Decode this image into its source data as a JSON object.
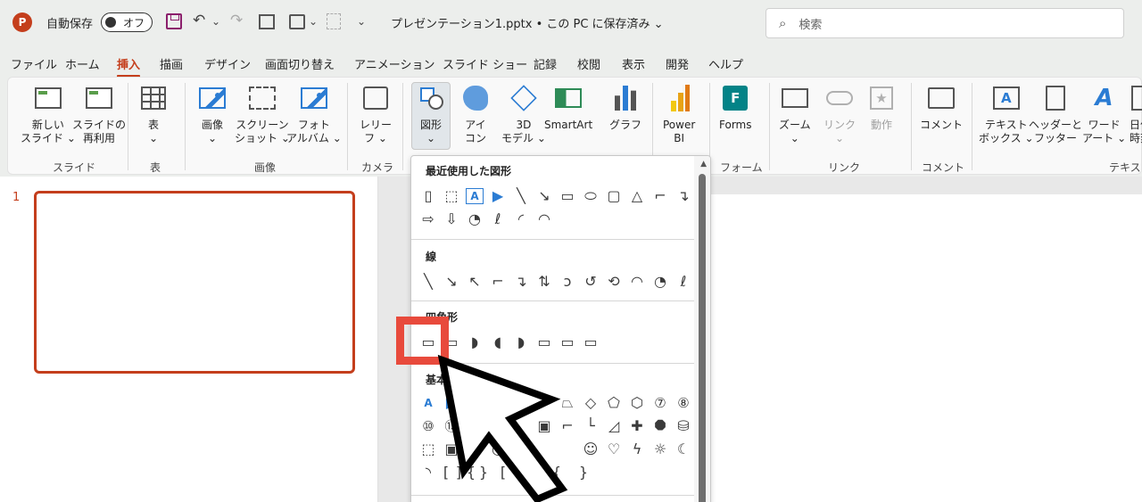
{
  "titlebar": {
    "logo_letter": "P",
    "autosave_label": "自動保存",
    "autosave_state": "オフ",
    "undo_glyph": "↶",
    "redo_glyph": "↷",
    "dropdown_glyph": "⌄",
    "doc_title": "プレゼンテーション1.pptx • この PC に保存済み ⌄",
    "search_placeholder": "検索"
  },
  "menu_tabs": [
    "ファイル",
    "ホーム",
    "挿入",
    "描画",
    "デザイン",
    "画面切り替え",
    "アニメーション",
    "スライド ショー",
    "記録",
    "校閲",
    "表示",
    "開発",
    "ヘルプ"
  ],
  "active_tab": "挿入",
  "ribbon": {
    "new_slide": "新しい\nスライド ⌄",
    "reuse_slide": "スライドの\n再利用",
    "table": "表\n⌄",
    "images": "画像\n⌄",
    "screenshot": "スクリーン\nショット ⌄",
    "photo_album": "フォト\nアルバム ⌄",
    "cameo": "レリー\nフ ⌄",
    "shapes": "図形\n⌄",
    "icons": "アイ\nコン",
    "model3d": "3D\nモデル ⌄",
    "smartart": "SmartArt",
    "chart": "グラフ",
    "powerbi": "Power\nBI",
    "forms": "Forms",
    "zoom": "ズーム\n⌄",
    "link": "リンク\n⌄",
    "action": "動作",
    "comment": "コメント",
    "textbox": "テキスト\nボックス ⌄",
    "header_footer": "ヘッダーと\nフッター",
    "wordart": "ワード\nアート ⌄",
    "date": "日付\n時刻",
    "groups": {
      "slides": "スライド",
      "tables": "表",
      "images": "画像",
      "camera": "カメラ",
      "forms": "フォーム",
      "links": "リンク",
      "comments": "コメント",
      "text": "テキスト"
    },
    "forms_icon_letter": "F",
    "textbox_icon_letter": "A",
    "wordart_icon_letter": "A",
    "action_icon_glyph": "★"
  },
  "slide_pane": {
    "slide_number": "1"
  },
  "shapes_menu": {
    "recent_header": "最近使用した図形",
    "recent_row1": [
      "▯",
      "⬚",
      "A",
      "▶",
      "╲",
      "↘",
      "▭",
      "⬭",
      "▢",
      "△",
      "⌐",
      "↴"
    ],
    "recent_row2": [
      "⇨",
      "⇩",
      "◔",
      "ℓ",
      "◜",
      "◠"
    ],
    "lines_header": "線",
    "lines_row": [
      "╲",
      "↘",
      "↖",
      "⌐",
      "↴",
      "⇅",
      "ↄ",
      "↺",
      "⟲",
      "◠",
      "◔",
      "ℓ"
    ],
    "rect_header": "四角形",
    "rect_row": [
      "▭",
      "▭",
      "◗",
      "◖",
      "◗",
      "▭",
      "▭",
      "▭"
    ],
    "basic_header": "基本",
    "basic_row1": [
      "A",
      "▶",
      "",
      "",
      "",
      "",
      "⏢",
      "◇",
      "⬠",
      "⬡",
      "⑦",
      "⑧"
    ],
    "basic_row2": [
      "⑩",
      "⑫",
      "",
      "",
      "",
      "▣",
      "⌐",
      "└",
      "◿",
      "✚",
      "⯃",
      "⛁"
    ],
    "basic_row3": [
      "⬚",
      "▣",
      "◔",
      "◎",
      "",
      "",
      "",
      "☺",
      "♡",
      "ϟ",
      "☼",
      "☾",
      "☁"
    ],
    "basic_row4": [
      "◝",
      "[",
      "]",
      "{",
      "}",
      "[",
      "]",
      "{",
      "}"
    ]
  },
  "colors": {
    "accent": "#c43e1c",
    "highlight": "#e84a3c",
    "ribbon_bg": "#f9f9f9",
    "titlebar_bg": "#eceeec"
  }
}
